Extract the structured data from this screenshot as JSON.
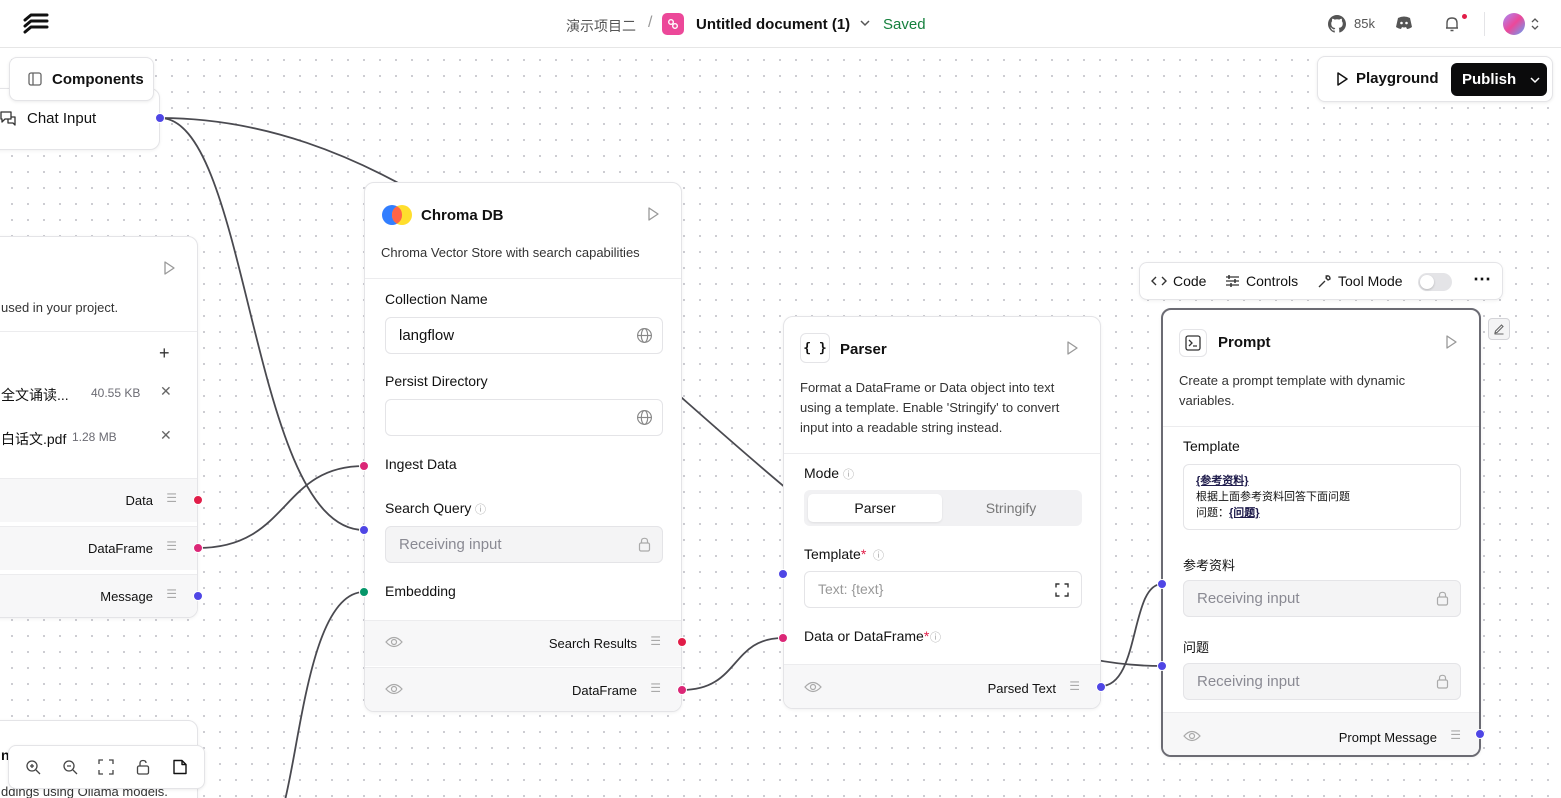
{
  "header": {
    "project": "演示项目二",
    "separator": "/",
    "document_title": "Untitled document (1)",
    "save_status": "Saved",
    "github_stars": "85k"
  },
  "canvas_controls": {
    "components_label": "Components",
    "playground_label": "Playground",
    "publish_label": "Publish"
  },
  "chat_input": {
    "title": "Chat Input"
  },
  "file_node": {
    "description": "used in your project.",
    "files": [
      {
        "name": "全文诵读...",
        "size": "40.55 KB"
      },
      {
        "name": "白话文.pdf",
        "size": "1.28 MB"
      }
    ],
    "outputs": [
      "Data",
      "DataFrame",
      "Message"
    ]
  },
  "ollama_node": {
    "title_fragment": "nl",
    "description": "ddings using Ollama models."
  },
  "chroma_node": {
    "title": "Chroma DB",
    "description": "Chroma Vector Store with search capabilities",
    "collection_label": "Collection Name",
    "collection_value": "langflow",
    "persist_label": "Persist Directory",
    "persist_value": "",
    "ingest_label": "Ingest Data",
    "search_query_label": "Search Query",
    "search_query_placeholder": "Receiving input",
    "embedding_label": "Embedding",
    "outputs": [
      "Search Results",
      "DataFrame"
    ]
  },
  "parser_node": {
    "title": "Parser",
    "icon_text": "{ }",
    "description": "Format a DataFrame or Data object into text using a template. Enable 'Stringify' to convert input into a readable string instead.",
    "mode_label": "Mode",
    "mode_options": [
      "Parser",
      "Stringify"
    ],
    "mode_selected": "Parser",
    "template_label": "Template",
    "template_placeholder": "Text: {text}",
    "data_label": "Data or DataFrame",
    "required_mark": "*",
    "output": "Parsed Text"
  },
  "prompt_toolbar": {
    "code": "Code",
    "controls": "Controls",
    "tool_mode": "Tool Mode",
    "tool_mode_on": false
  },
  "prompt_node": {
    "title": "Prompt",
    "description": "Create a prompt template with dynamic variables.",
    "template_label": "Template",
    "template_lines": [
      "{参考资料}",
      "根据上面参考资料回答下面问题",
      "问题：{问题}"
    ],
    "template_var_ref": "{参考资料}",
    "template_body": "根据上面参考资料回答下面问题",
    "template_q_prefix": "问题：",
    "template_var_q": "{问题}",
    "var1_label": "参考资料",
    "var2_label": "问题",
    "input_placeholder": "Receiving input",
    "output": "Prompt Message"
  },
  "colors": {
    "handle_blue": "#4f46e5",
    "handle_red": "#e11d48",
    "handle_pink": "#db2777",
    "handle_green": "#059669",
    "saved_green": "#15803d",
    "brand_pink": "#ec4899"
  }
}
